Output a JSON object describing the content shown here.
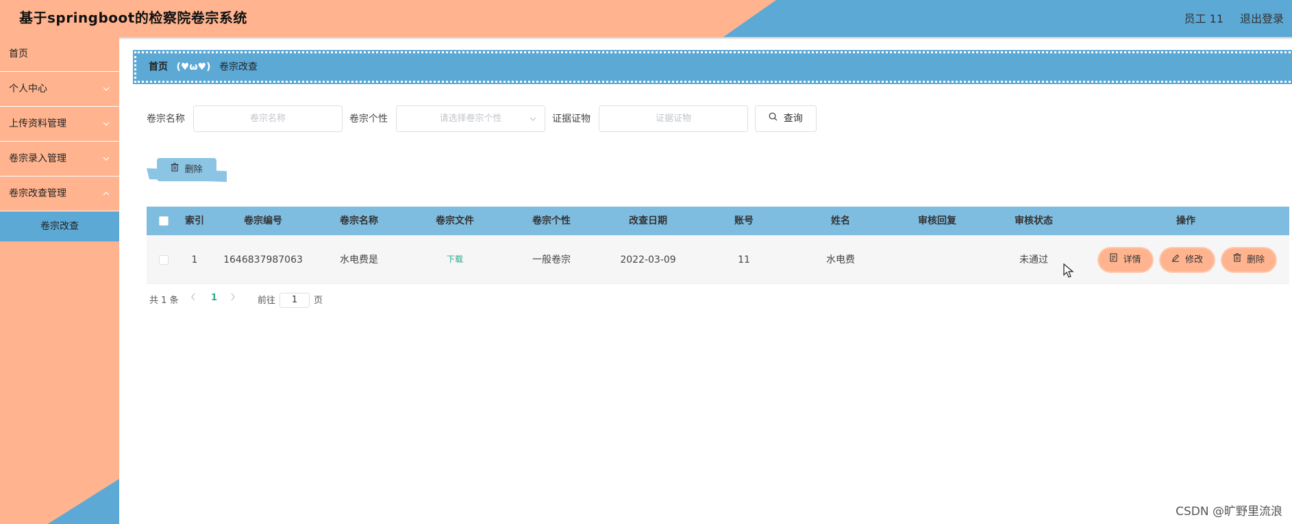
{
  "header": {
    "title": "基于springboot的检察院卷宗系统",
    "user": "员工 11",
    "logout": "退出登录"
  },
  "sidebar": {
    "items": [
      {
        "label": "首页",
        "has_children": false
      },
      {
        "label": "个人中心",
        "has_children": true
      },
      {
        "label": "上传资料管理",
        "has_children": true
      },
      {
        "label": "卷宗录入管理",
        "has_children": true
      },
      {
        "label": "卷宗改查管理",
        "has_children": true
      }
    ],
    "active_sub": "卷宗改查"
  },
  "breadcrumb": {
    "home": "首页",
    "separator": "(♥ω♥)",
    "current": "卷宗改查"
  },
  "search": {
    "name_label": "卷宗名称",
    "name_placeholder": "卷宗名称",
    "type_label": "卷宗个性",
    "type_placeholder": "请选择卷宗个性",
    "evidence_label": "证据证物",
    "evidence_placeholder": "证据证物",
    "query_button": "查询"
  },
  "actions": {
    "delete_button": "删除"
  },
  "table": {
    "columns": [
      "索引",
      "卷宗编号",
      "卷宗名称",
      "卷宗文件",
      "卷宗个性",
      "改查日期",
      "账号",
      "姓名",
      "审核回复",
      "审核状态",
      "操作"
    ],
    "rows": [
      {
        "index": "1",
        "number": "1646837987063",
        "name": "水电费是",
        "file": "下载",
        "type": "一般卷宗",
        "date": "2022-03-09",
        "account": "11",
        "person": "水电费",
        "reply": "",
        "status": "未通过",
        "ops": [
          "详情",
          "修改",
          "删除"
        ]
      }
    ]
  },
  "pagination": {
    "total": "共 1 条",
    "current_page": "1",
    "goto_label": "前往",
    "goto_value": "1",
    "page_suffix": "页"
  },
  "watermark": "CSDN @旷野里流浪",
  "colors": {
    "peach": "#ffb48f",
    "blue": "#5ca9d6",
    "table_header": "#7fbde0",
    "link_green": "#2aa88a"
  }
}
